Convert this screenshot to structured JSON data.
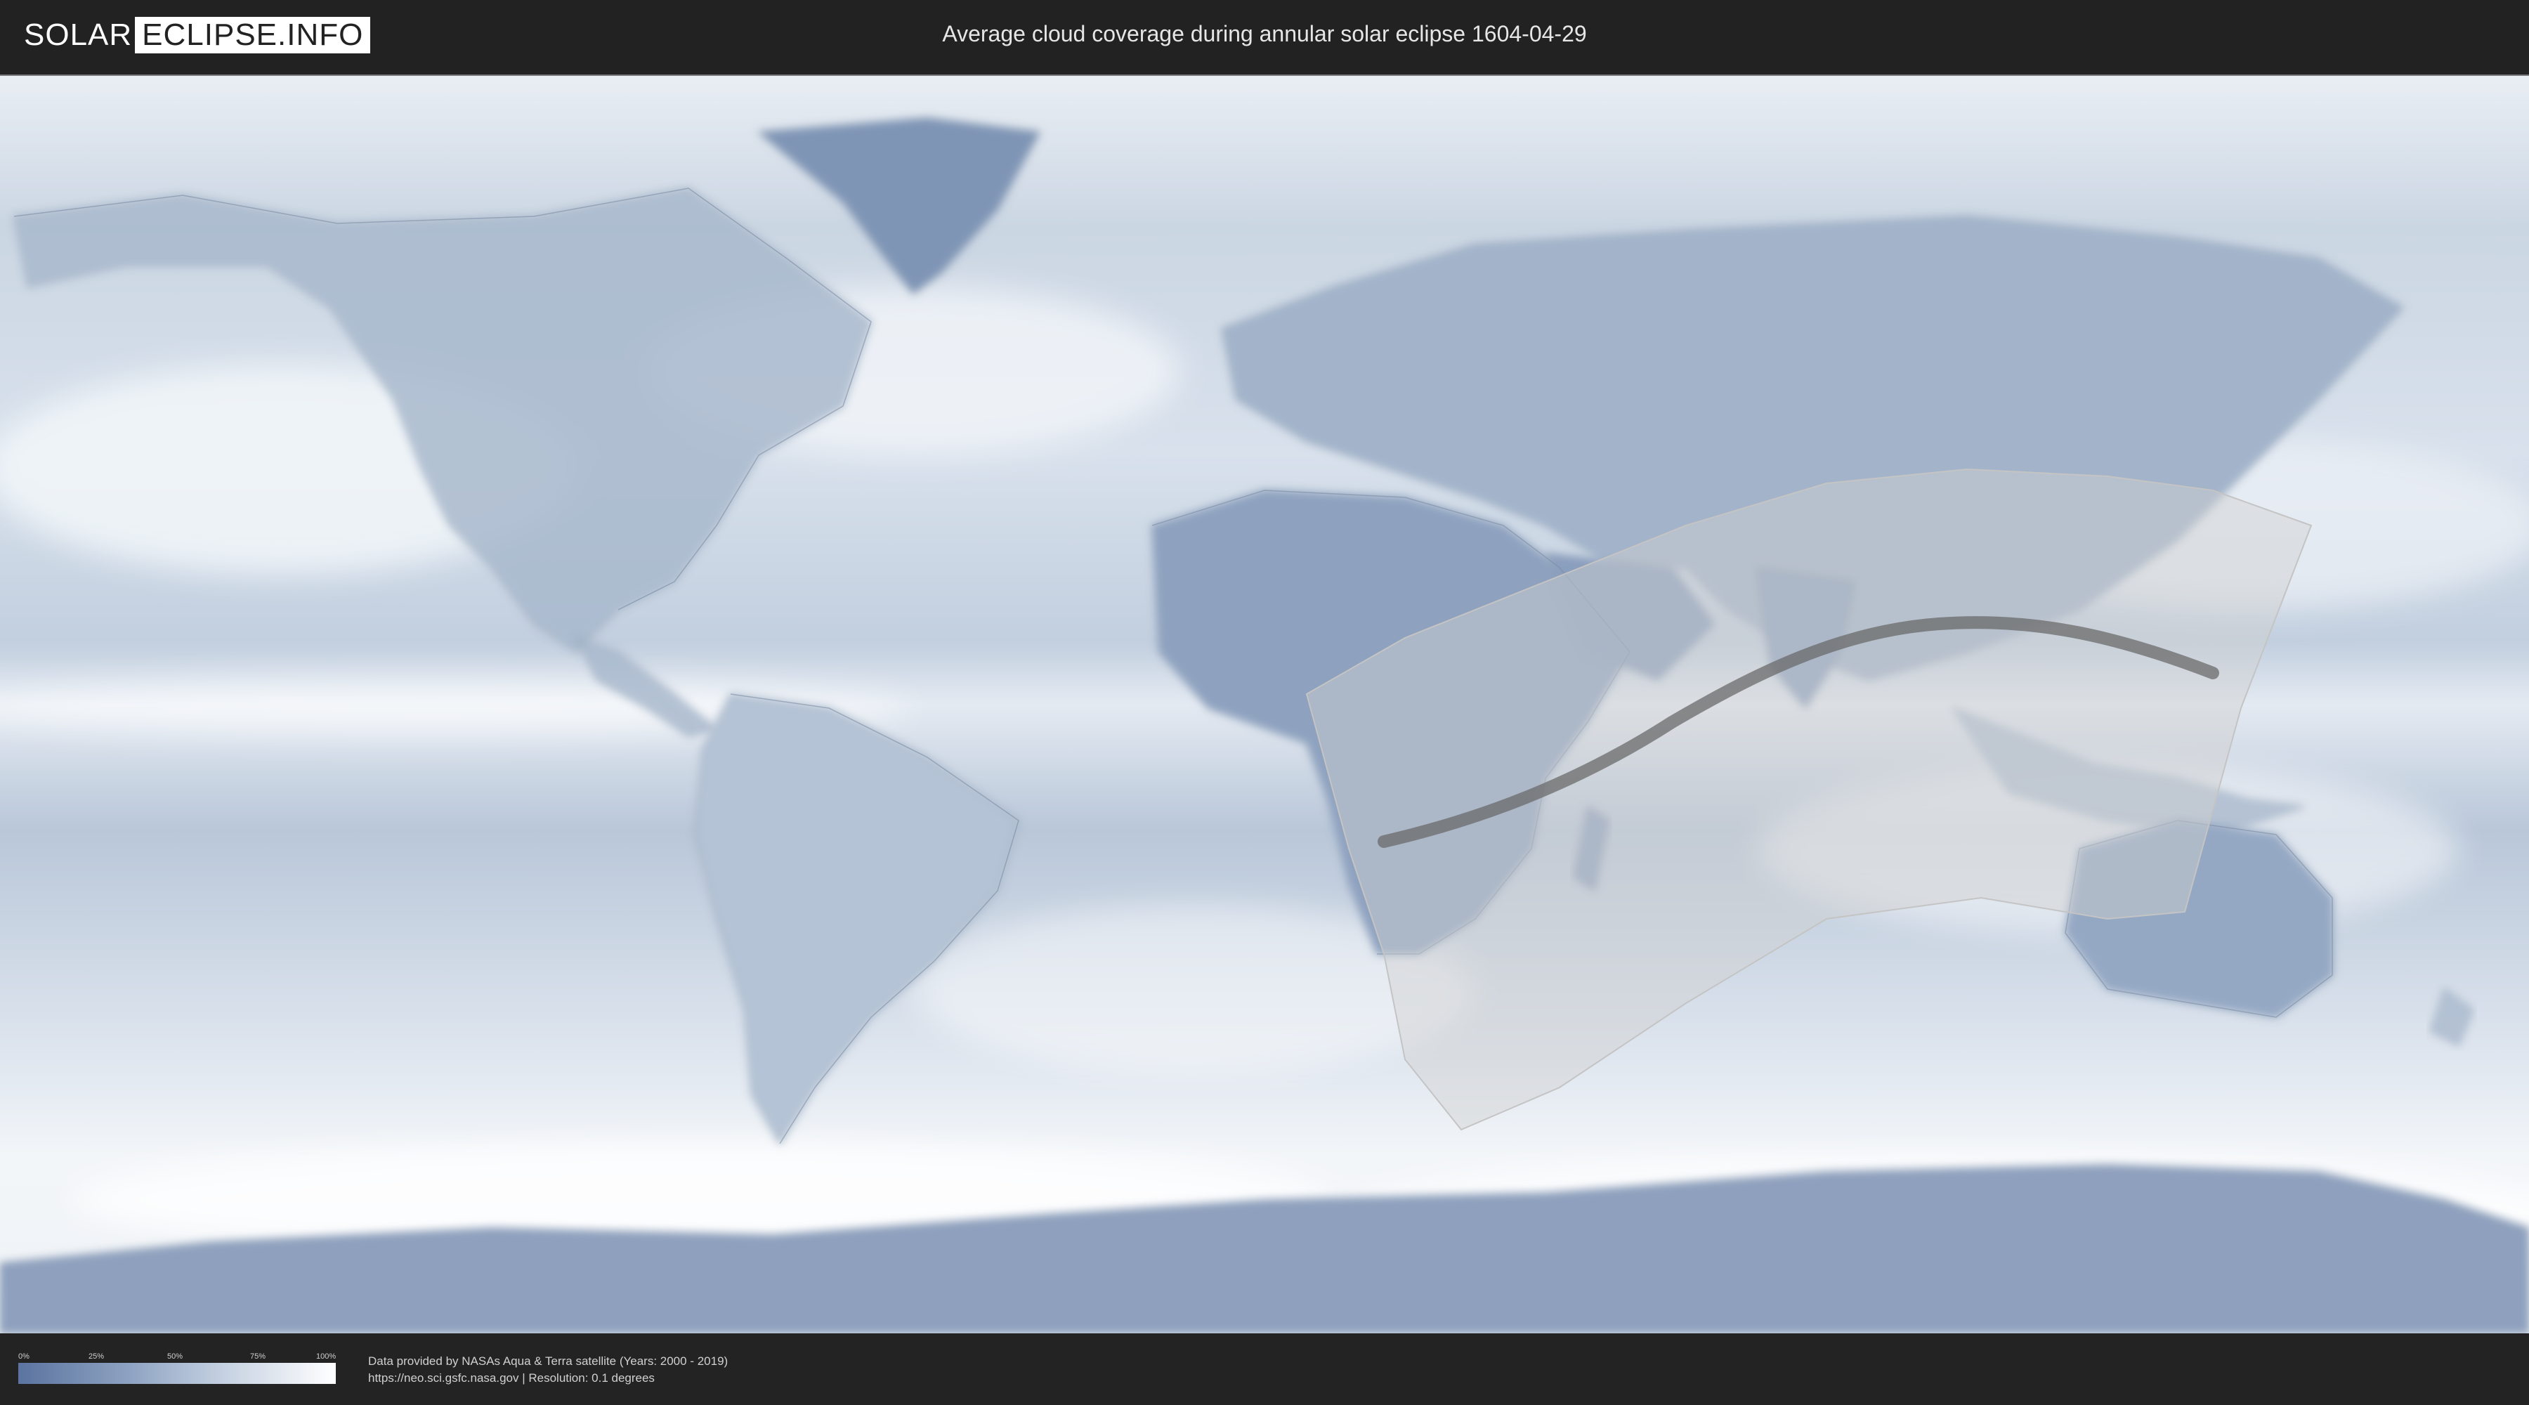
{
  "header": {
    "logo_solar": "SOLAR",
    "logo_eclipse": "ECLIPSE.INFO",
    "title": "Average cloud coverage during annular solar eclipse 1604-04-29"
  },
  "map": {
    "ocean_color": "#b9c7d8",
    "land_color": "#a7b7cc",
    "shadow_color": "#cccccc",
    "path_color": "#666666"
  },
  "legend": {
    "ticks": [
      "0%",
      "25%",
      "50%",
      "75%",
      "100%"
    ],
    "low_color": "#5b74a0",
    "high_color": "#ffffff"
  },
  "credits": {
    "line1": "Data provided by NASAs Aqua & Terra satellite (Years: 2000 - 2019)",
    "line2": "https://neo.sci.gsfc.nasa.gov | Resolution: 0.1 degrees"
  }
}
